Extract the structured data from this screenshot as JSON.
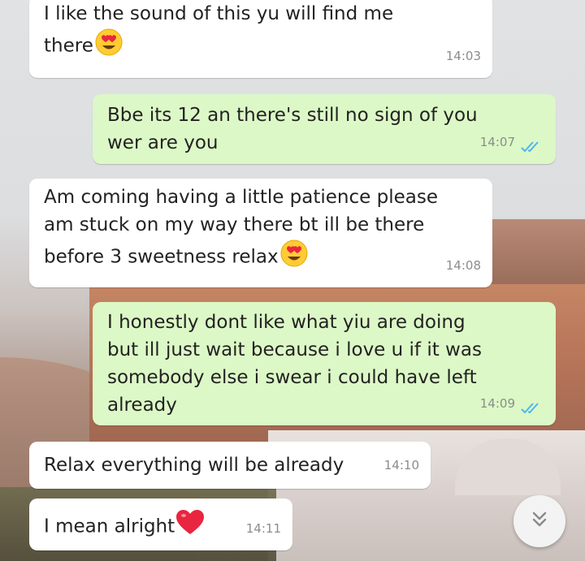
{
  "messages": [
    {
      "direction": "incoming",
      "text": "I like the sound of this yu will find me\nthere",
      "emoji": "heart-eyes",
      "time": "14:03"
    },
    {
      "direction": "outgoing",
      "text": "Bbe its 12 an there's still no sign of you\nwer are you",
      "time": "14:07",
      "status": "read"
    },
    {
      "direction": "incoming",
      "text": "Am coming having a little patience please\nam stuck on my way there bt ill be there\nbefore 3 sweetness relax",
      "emoji": "heart-eyes",
      "time": "14:08"
    },
    {
      "direction": "outgoing",
      "text": "I honestly dont like what yiu are doing\nbut ill just wait because i love u if it was\nsomebody else i swear i could have left\nalready",
      "time": "14:09",
      "status": "read"
    },
    {
      "direction": "incoming",
      "text": "Relax everything will be already",
      "time": "14:10"
    },
    {
      "direction": "incoming",
      "text": "I mean alright",
      "emoji": "red-heart",
      "time": "14:11"
    }
  ],
  "colors": {
    "incoming_bubble": "#ffffff",
    "outgoing_bubble": "#dcf8c6",
    "read_ticks": "#4fb6ec",
    "timestamp": "#8c8c8c"
  },
  "scroll_button": {
    "icon": "double-chevron-down-icon"
  }
}
